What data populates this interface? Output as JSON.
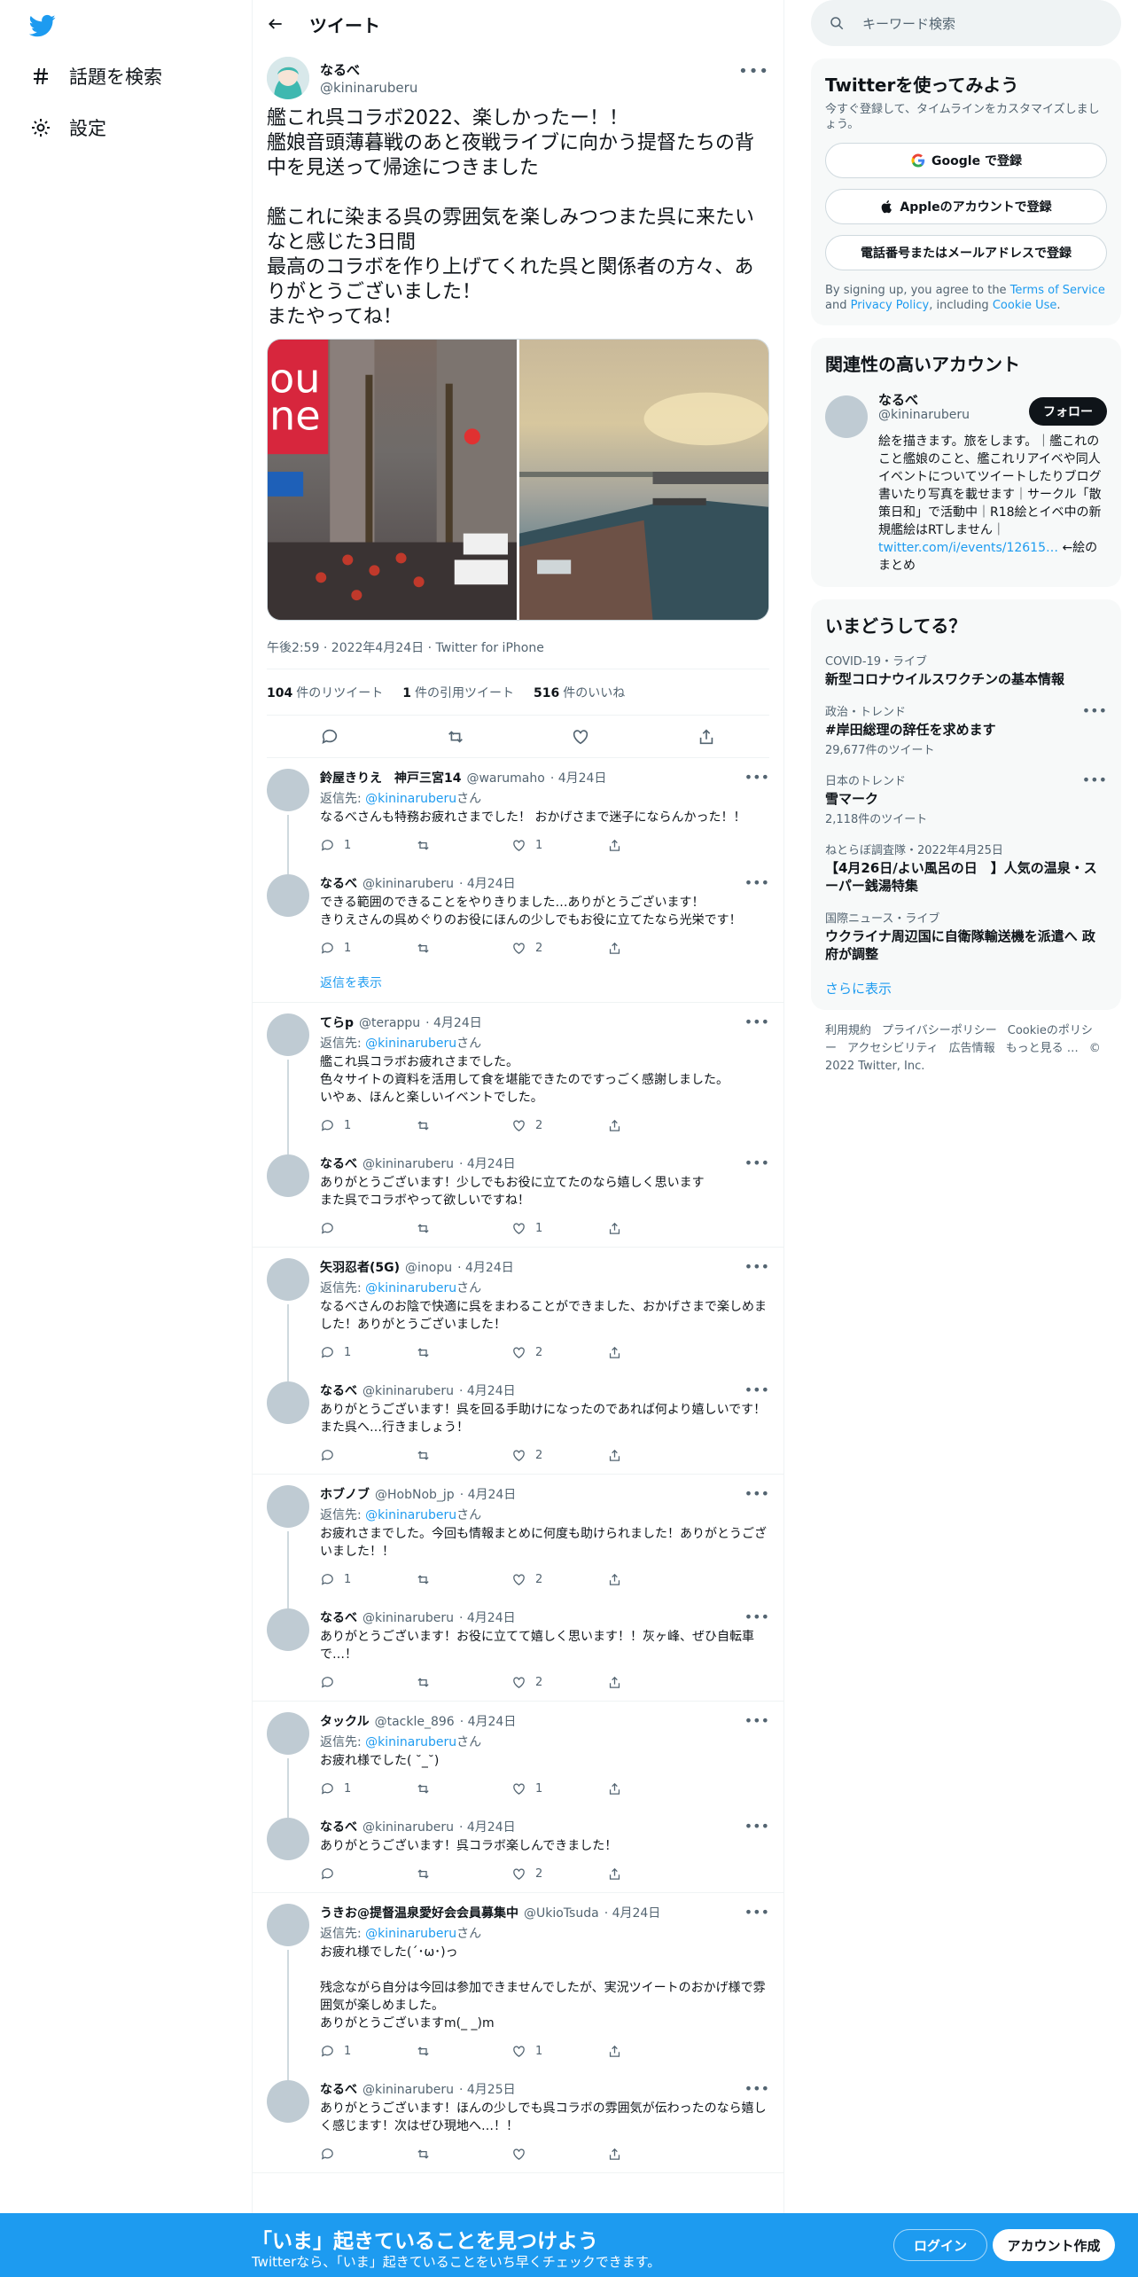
{
  "nav": {
    "explore": "話題を検索",
    "settings": "設定"
  },
  "header": {
    "title": "ツイート"
  },
  "tweet": {
    "name": "なるべ",
    "handle": "@kininaruberu",
    "text": "艦これ呉コラボ2022、楽しかったー！！\n艦娘音頭薄暮戦のあと夜戦ライブに向かう提督たちの背中を見送って帰途につきました\n\n艦これに染まる呉の雰囲気を楽しみつつまた呉に来たいなと感じた3日間\n最高のコラボを作り上げてくれた呉と関係者の方々、ありがとうございました！\nまたやってね！",
    "meta": "午後2:59 · 2022年4月24日 · Twitter for iPhone",
    "retweets": "104",
    "retweets_label": "件のリツイート",
    "quotes": "1",
    "quotes_label": "件の引用ツイート",
    "likes": "516",
    "likes_label": "件のいいね"
  },
  "replies": [
    {
      "name": "鈴屋きりえ　神戸三宮14",
      "handle": "@warumaho",
      "date": "· 4月24日",
      "to_prefix": "返信先:",
      "to_handle": "@kininaruberu",
      "to_suffix": "さん",
      "text": "なるべさんも特務お疲れさまでした！ おかげさまで迷子にならんかった！！",
      "reply": "1",
      "rt": "",
      "like": "1",
      "thread": true
    },
    {
      "name": "なるべ",
      "handle": "@kininaruberu",
      "date": "· 4月24日",
      "text": "できる範囲のできることをやりきりました…ありがとうございます！\nきりえさんの呉めぐりのお役にほんの少しでもお役に立てたなら光栄です！",
      "reply": "1",
      "rt": "",
      "like": "2",
      "thread": false,
      "show": "返信を表示"
    },
    {
      "name": "てらp",
      "handle": "@terappu",
      "date": "· 4月24日",
      "to_prefix": "返信先:",
      "to_handle": "@kininaruberu",
      "to_suffix": "さん",
      "text": "艦これ呉コラボお疲れさまでした。\n色々サイトの資料を活用して食を堪能できたのですっごく感謝しました。\nいやぁ、ほんと楽しいイベントでした。",
      "reply": "1",
      "rt": "",
      "like": "2",
      "thread": true
    },
    {
      "name": "なるべ",
      "handle": "@kininaruberu",
      "date": "· 4月24日",
      "text": "ありがとうございます！少しでもお役に立てたのなら嬉しく思います\nまた呉でコラボやって欲しいですね！",
      "reply": "",
      "rt": "",
      "like": "1",
      "thread": false
    },
    {
      "name": "矢羽忍者(5G)",
      "handle": "@inopu",
      "date": "· 4月24日",
      "to_prefix": "返信先:",
      "to_handle": "@kininaruberu",
      "to_suffix": "さん",
      "text": "なるべさんのお陰で快適に呉をまわることができました、おかげさまで楽しめました！ありがとうございました！",
      "reply": "1",
      "rt": "",
      "like": "2",
      "thread": true
    },
    {
      "name": "なるべ",
      "handle": "@kininaruberu",
      "date": "· 4月24日",
      "text": "ありがとうございます！呉を回る手助けになったのであれば何より嬉しいです！\nまた呉へ…行きましょう！",
      "reply": "",
      "rt": "",
      "like": "2",
      "thread": false
    },
    {
      "name": "ホブノブ",
      "handle": "@HobNob_jp",
      "date": "· 4月24日",
      "to_prefix": "返信先:",
      "to_handle": "@kininaruberu",
      "to_suffix": "さん",
      "text": "お疲れさまでした。今回も情報まとめに何度も助けられました！ありがとうございました！！",
      "reply": "1",
      "rt": "",
      "like": "2",
      "thread": true
    },
    {
      "name": "なるべ",
      "handle": "@kininaruberu",
      "date": "· 4月24日",
      "text": "ありがとうございます！お役に立てて嬉しく思います！！灰ヶ峰、ぜひ自転車で…！",
      "reply": "",
      "rt": "",
      "like": "2",
      "thread": false
    },
    {
      "name": "タックル",
      "handle": "@tackle_896",
      "date": "· 4月24日",
      "to_prefix": "返信先:",
      "to_handle": "@kininaruberu",
      "to_suffix": "さん",
      "text": "お疲れ様でした( ˘_˘)",
      "reply": "1",
      "rt": "",
      "like": "1",
      "thread": true
    },
    {
      "name": "なるべ",
      "handle": "@kininaruberu",
      "date": "· 4月24日",
      "text": "ありがとうございます！呉コラボ楽しんできました！",
      "reply": "",
      "rt": "",
      "like": "2",
      "thread": false
    },
    {
      "name": "うきお@提督温泉愛好会会員募集中",
      "handle": "@UkioTsuda",
      "date": "· 4月24日",
      "to_prefix": "返信先:",
      "to_handle": "@kininaruberu",
      "to_suffix": "さん",
      "text": "お疲れ様でした(´･ω･)っ\n\n残念ながら自分は今回は参加できませんでしたが、実況ツイートのおかげ様で雰囲気が楽しめました。\nありがとうございますm(_ _)m",
      "reply": "1",
      "rt": "",
      "like": "1",
      "thread": true
    },
    {
      "name": "なるべ",
      "handle": "@kininaruberu",
      "date": "· 4月25日",
      "text": "ありがとうございます！ほんの少しでも呉コラボの雰囲気が伝わったのなら嬉しく感じます！次はぜひ現地へ…！！",
      "reply": "",
      "rt": "",
      "like": "",
      "thread": false
    }
  ],
  "sidebar": {
    "search_placeholder": "キーワード検索",
    "signup": {
      "title": "Twitterを使ってみよう",
      "subtitle": "今すぐ登録して、タイムラインをカスタマイズしましょう。",
      "google": "Google で登録",
      "apple": "Appleのアカウントで登録",
      "phone": "電話番号またはメールアドレスで登録",
      "terms_pre": "By signing up, you agree to the",
      "terms": "Terms of Service",
      "and": "and",
      "privacy": "Privacy Policy",
      "including": ", including",
      "cookie": "Cookie Use",
      "end": "."
    },
    "related": {
      "title": "関連性の高いアカウント",
      "name": "なるべ",
      "handle": "@kininaruberu",
      "follow": "フォロー",
      "bio": "絵を描きます。旅をします。｜艦これのこと艦娘のこと、艦これリアイベや同人イベントについてツイートしたりブログ書いたり写真を載せます｜サークル「散策日和」で活動中｜R18絵とイベ中の新規艦絵はRTしません｜",
      "bio_link": "twitter.com/i/events/12615…",
      "bio_end": " ←絵のまとめ"
    },
    "trends": {
      "title": "いまどうしてる？",
      "items": [
        {
          "category": "COVID-19・ライブ",
          "name": "新型コロナウイルスワクチンの基本情報",
          "count": ""
        },
        {
          "category": "政治・トレンド",
          "name": "#岸田総理の辞任を求めます",
          "count": "29,677件のツイート"
        },
        {
          "category": "日本のトレンド",
          "name": "雪マーク",
          "count": "2,118件のツイート"
        },
        {
          "category": "ねとらぼ調査隊・2022年4月25日",
          "name": "【4月26日/よい風呂の日　】人気の温泉・スーパー銭湯特集",
          "count": ""
        },
        {
          "category": "国際ニュース・ライブ",
          "name": "ウクライナ周辺国に自衛隊輸送機を派遣へ 政府が調整",
          "count": ""
        }
      ],
      "more": "さらに表示"
    },
    "footer": [
      "利用規約",
      "プライバシーポリシー",
      "Cookieのポリシー",
      "アクセシビリティ",
      "広告情報",
      "もっと見る …",
      "© 2022 Twitter, Inc."
    ]
  },
  "bottom": {
    "headline": "「いま」起きていることを見つけよう",
    "sub": "Twitterなら、「いま」起きていることをいち早くチェックできます。",
    "login": "ログイン",
    "signup": "アカウント作成"
  },
  "colors": {
    "accent": "#1d9bf0",
    "text": "#0f1419",
    "muted": "#536471"
  }
}
